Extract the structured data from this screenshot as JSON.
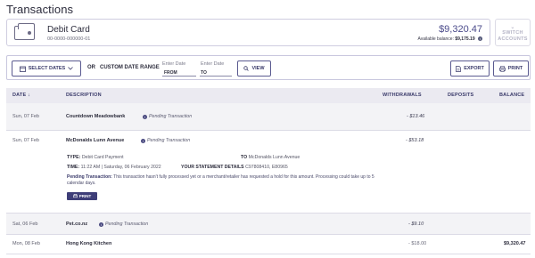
{
  "page": {
    "title": "Transactions"
  },
  "account": {
    "name": "Debit Card",
    "number": "00-0000-000000-01",
    "balance": "$9,320.47",
    "available_label": "Available balance:",
    "available_value": "$9,175.19",
    "info_glyph": "i"
  },
  "switch_accounts": {
    "label_line1": "SWITCH",
    "label_line2": "ACCOUNTS",
    "chevron": "⌄"
  },
  "filters": {
    "select_dates_label": "SELECT DATES",
    "or_label": "OR",
    "custom_range_label": "CUSTOM DATE RANGE",
    "from_placeholder": "Enter Date",
    "from_tag": "FROM",
    "to_placeholder": "Enter Date",
    "to_tag": "TO",
    "view_label": "VIEW",
    "export_label": "EXPORT",
    "print_label": "PRINT"
  },
  "table": {
    "columns": {
      "date": "DATE",
      "date_sort_glyph": "↓",
      "description": "DESCRIPTION",
      "withdrawals": "WITHDRAWALS",
      "deposits": "DEPOSITS",
      "balance": "BALANCE"
    },
    "rows": [
      {
        "date": "Sun, 07 Feb",
        "description": "Countdown Meadowbank",
        "pending": "Pending Transaction",
        "withdrawal": "- $13.46",
        "deposit": "",
        "balance": ""
      },
      {
        "date": "Sun, 07 Feb",
        "description": "McDonalds Lunn Avenue",
        "pending": "Pending Transaction",
        "withdrawal": "- $53.18",
        "deposit": "",
        "balance": ""
      },
      {
        "date": "Sat, 06 Feb",
        "description": "Pet.co.nz",
        "pending": "Pending Transaction",
        "withdrawal": "- $9.10",
        "deposit": "",
        "balance": ""
      },
      {
        "date": "Mon, 08 Feb",
        "description": "Hong Kong Kitchen",
        "pending": "",
        "withdrawal": "- $18.00",
        "deposit": "",
        "balance": "$9,320.47"
      }
    ],
    "detail": {
      "type_label": "TYPE:",
      "type_value": "Debit Card Payment",
      "to_label": "TO",
      "to_value": "McDonalds Lunn Avenue",
      "time_label": "TIME:",
      "time_value": "11:22 AM | Saturday, 06 February 2022",
      "statement_label": "YOUR STATEMENT DETAILS",
      "statement_value": "C97808410, E80965",
      "note_title": "Pending Transaction:",
      "note_text": "This transaction hasn't fully processed yet or a merchant/retailer has requested a hold for this amount. Processing could take up to 5 calendar days.",
      "print_label": "PRINT"
    }
  },
  "colors": {
    "accent": "#3e3e78",
    "balance_text": "#4a4a8a",
    "header_bg": "#ebeaf1",
    "row_alt_bg": "#f3f3f6"
  }
}
